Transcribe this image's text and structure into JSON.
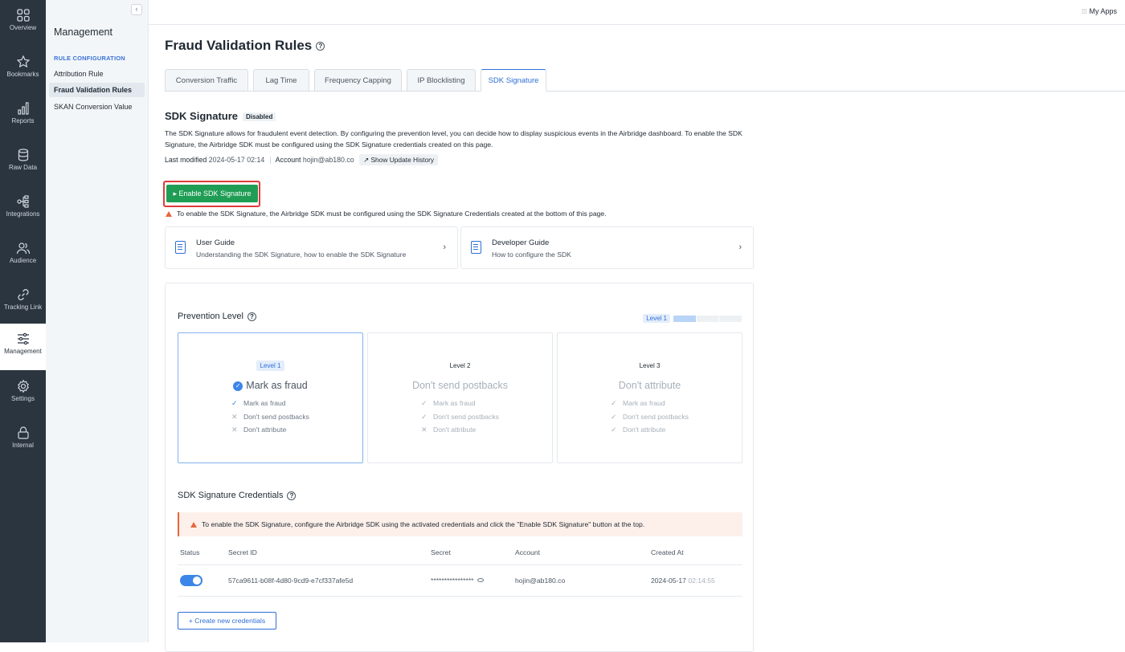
{
  "rail": [
    {
      "label": "Overview",
      "icon": "grid-icon"
    },
    {
      "label": "Bookmarks",
      "icon": "star-icon"
    },
    {
      "label": "Reports",
      "icon": "bar-chart-icon"
    },
    {
      "label": "Raw Data",
      "icon": "database-icon"
    },
    {
      "label": "Integrations",
      "icon": "integrations-icon"
    },
    {
      "label": "Audience",
      "icon": "users-icon"
    },
    {
      "label": "Tracking Link",
      "icon": "link-icon"
    },
    {
      "label": "Management",
      "icon": "sliders-icon"
    },
    {
      "label": "Settings",
      "icon": "gear-icon"
    },
    {
      "label": "Internal",
      "icon": "lock-icon"
    }
  ],
  "sidebar": {
    "title": "Management",
    "section": "RULE CONFIGURATION",
    "items": [
      "Attribution Rule",
      "Fraud Validation Rules",
      "SKAN Conversion Value"
    ],
    "collapse": "‹"
  },
  "topbar": {
    "my_apps": "My Apps"
  },
  "page": {
    "title": "Fraud Validation Rules",
    "help": "?"
  },
  "tabs": [
    "Conversion Traffic",
    "Lag Time",
    "Frequency Capping",
    "IP Blocklisting",
    "SDK Signature"
  ],
  "sdk": {
    "title": "SDK Signature",
    "status": "Disabled",
    "description": "The SDK Signature allows for fraudulent event detection. By configuring the prevention level, you can decide how to display suspicious events in the Airbridge dashboard. To enable the SDK Signature, the Airbridge SDK must be configured using the SDK Signature credentials created on this page.",
    "last_modified_label": "Last modified",
    "last_modified": "2024-05-17 02:14",
    "account_label": "Account",
    "account": "hojin@ab180.co",
    "history_button": "↗ Show Update History",
    "enable_button": "▸  Enable SDK Signature",
    "enable_warning": "To enable the SDK Signature, the Airbridge SDK must be configured using the SDK Signature Credentials created at the bottom of this page."
  },
  "guides": [
    {
      "title": "User Guide",
      "subtitle": "Understanding the SDK Signature, how to enable the SDK Signature",
      "chevron": "›"
    },
    {
      "title": "Developer Guide",
      "subtitle": "How to configure the SDK",
      "chevron": "›"
    }
  ],
  "prevention": {
    "title": "Prevention Level",
    "current_label": "Level 1",
    "current_fraction": 0.333,
    "levels": [
      {
        "pill": "Level 1",
        "name": "Mark as fraud",
        "selected": true,
        "items": [
          {
            "text": "Mark as fraud",
            "mark": "✓"
          },
          {
            "text": "Don't send postbacks",
            "mark": "✕"
          },
          {
            "text": "Don't attribute",
            "mark": "✕"
          }
        ]
      },
      {
        "pill": "Level 2",
        "name": "Don't send postbacks",
        "selected": false,
        "items": [
          {
            "text": "Mark as fraud",
            "mark": "✓"
          },
          {
            "text": "Don't send postbacks",
            "mark": "✓"
          },
          {
            "text": "Don't attribute",
            "mark": "✕"
          }
        ]
      },
      {
        "pill": "Level 3",
        "name": "Don't attribute",
        "selected": false,
        "items": [
          {
            "text": "Mark as fraud",
            "mark": "✓"
          },
          {
            "text": "Don't send postbacks",
            "mark": "✓"
          },
          {
            "text": "Don't attribute",
            "mark": "✓"
          }
        ]
      }
    ]
  },
  "credentials": {
    "title": "SDK Signature Credentials",
    "alert": "To enable the SDK Signature, configure the Airbridge SDK using the activated credentials and click the \"Enable SDK Signature\" button at the top.",
    "columns": [
      "Status",
      "Secret ID",
      "Secret",
      "Account",
      "Created At"
    ],
    "rows": [
      {
        "status": "on",
        "secret_id": "57ca9611-b08f-4d80-9cd9-e7cf337afe5d",
        "secret": "****************",
        "account": "hojin@ab180.co",
        "created_date": "2024-05-17",
        "created_time": "02:14:55"
      }
    ],
    "create_button": "+  Create new credentials"
  },
  "colors": {
    "accent": "#2f6fd6",
    "enable": "#1f9d55",
    "warn": "#e8663b",
    "rail": "#2b3540"
  }
}
